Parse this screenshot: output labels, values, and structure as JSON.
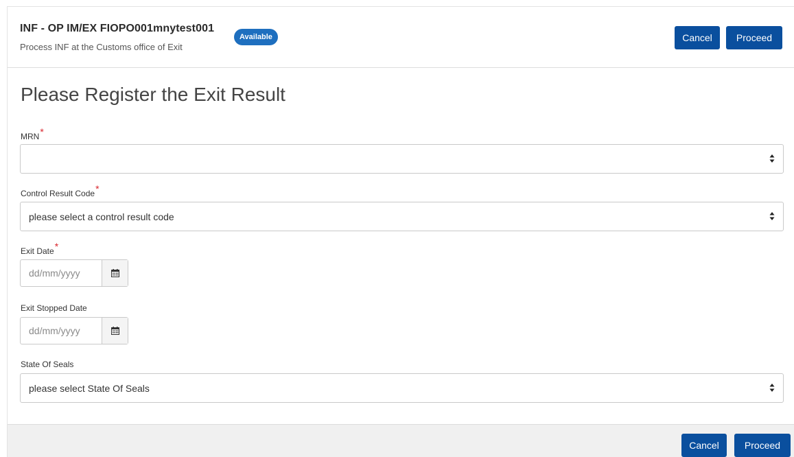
{
  "header": {
    "title": "INF - OP IM/EX FIOPO001mnytest001",
    "subtitle": "Process INF at the Customs office of Exit",
    "status_badge": "Available",
    "cancel_label": "Cancel",
    "proceed_label": "Proceed"
  },
  "main": {
    "page_title": "Please Register the Exit Result",
    "required_marker": "*",
    "mrn": {
      "label": "MRN",
      "value": ""
    },
    "control_result_code": {
      "label": "Control Result Code",
      "value": "please select a control result code"
    },
    "exit_date": {
      "label": "Exit Date",
      "placeholder": "dd/mm/yyyy"
    },
    "exit_stopped_date": {
      "label": "Exit Stopped Date",
      "placeholder": "dd/mm/yyyy"
    },
    "state_of_seals": {
      "label": "State Of Seals",
      "value": "please select State Of Seals"
    }
  },
  "footer": {
    "cancel_label": "Cancel",
    "proceed_label": "Proceed"
  },
  "colors": {
    "primary_button": "#0a4f9e",
    "badge": "#1e6fbf",
    "required": "#d9262e",
    "footer_bg": "#f0f0f0"
  },
  "icons": {
    "select_arrows": "sort-icon",
    "calendar": "calendar-icon"
  }
}
